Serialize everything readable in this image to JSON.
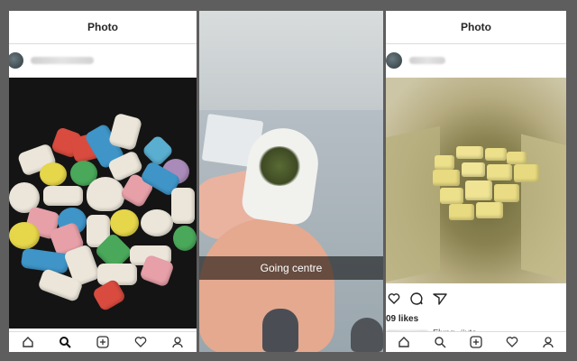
{
  "panels": {
    "left": {
      "header_title": "Photo"
    },
    "middle": {
      "snap_caption": "Going centre"
    },
    "right": {
      "header_title": "Photo",
      "likes": "09 likes",
      "caption": "Flxng. #xtc"
    }
  },
  "icons": {
    "tab_home": "home-icon",
    "tab_search": "search-icon",
    "tab_add": "add-post-icon",
    "tab_activity": "heart-icon",
    "tab_profile": "profile-icon",
    "like": "heart-outline-icon",
    "comment": "comment-icon",
    "share": "direct-share-icon"
  },
  "colors": {
    "pill_red": "#d94b3f",
    "pill_green": "#4aa85a",
    "pill_blue": "#3f95c8",
    "pill_yellow": "#e6d64a",
    "pill_pink": "#e7a0a8",
    "pill_white": "#ece6da",
    "pill_purple": "#a98ab8",
    "bag_pill_yellow": "#ede08a"
  }
}
